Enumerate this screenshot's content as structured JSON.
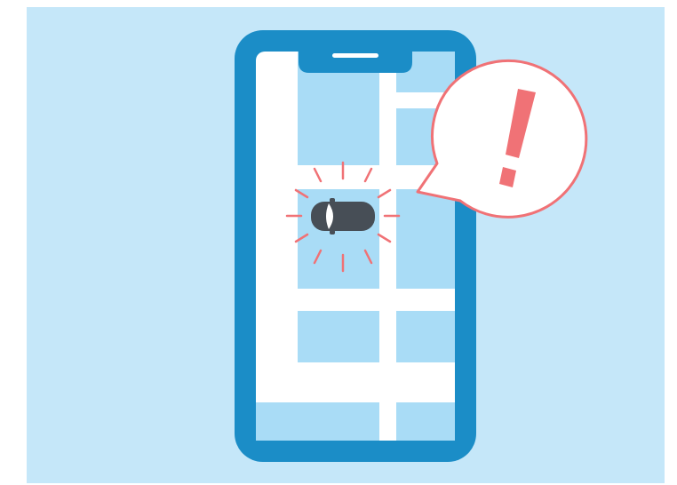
{
  "colors": {
    "background": "#c5e7f9",
    "phone_frame": "#1b8dc7",
    "screen_road": "#ffffff",
    "city_block": "#a9dcf6",
    "car_body": "#474e56",
    "car_windshield": "#ffffff",
    "alert_accent": "#f07276",
    "bubble_fill": "#ffffff",
    "notch_bar": "#ffffff"
  },
  "icons": {
    "phone": "smartphone-icon",
    "car": "car-icon",
    "alert": "exclamation-icon",
    "bubble": "speech-bubble-icon"
  },
  "alert": {
    "symbol": "!"
  }
}
